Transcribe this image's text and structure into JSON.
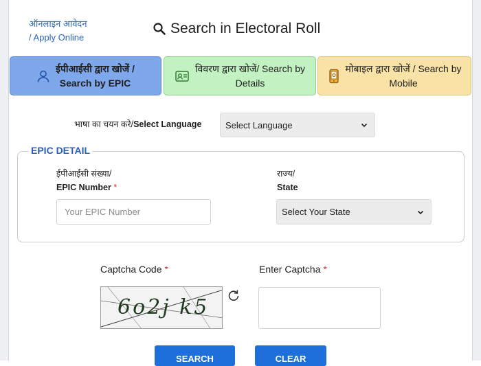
{
  "header": {
    "online_link_hi": "ऑनलाइन आवेदन",
    "online_link_en": "/ Apply Online",
    "title": "Search in Electoral Roll",
    "title_icon": "search-icon"
  },
  "tabs": [
    {
      "line1": "ईपीआईसी द्वारा खोजें /",
      "line2": "Search by EPIC",
      "icon": "person-icon",
      "active": true
    },
    {
      "line1": "विवरण द्वारा खोजें/ Search by",
      "line2": "Details",
      "icon": "id-card-icon",
      "active": false
    },
    {
      "line1": "मोबाइल द्वारा खोजें / Search by",
      "line2": "Mobile",
      "icon": "mobile-icon",
      "active": false
    }
  ],
  "language": {
    "label_hi": "भाषा का चयन करे/",
    "label_en": "Select Language",
    "selected": "Select Language"
  },
  "epic_detail": {
    "legend": "EPIC DETAIL",
    "epic_number": {
      "label_hi": "ईपीआईसी संख्या/",
      "label_en": "EPIC Number",
      "required_mark": "*",
      "placeholder": "Your EPIC Number"
    },
    "state": {
      "label_hi": "राज्य/",
      "label_en": "State",
      "selected": "Select Your State"
    }
  },
  "captcha": {
    "code_label": "Captcha Code",
    "enter_label": "Enter Captcha",
    "required_mark": "*",
    "image_text": "6o2j k5",
    "refresh_icon": "refresh-icon"
  },
  "buttons": {
    "search": "SEARCH",
    "clear": "CLEAR"
  },
  "colors": {
    "epic_tab": "#7fa8ec",
    "details_tab": "#c2f1c2",
    "mobile_tab": "#f9e2a5",
    "link": "#2b66b8",
    "legend": "#2b5fb5",
    "required": "#e03131",
    "button": "#1e6fd9"
  }
}
